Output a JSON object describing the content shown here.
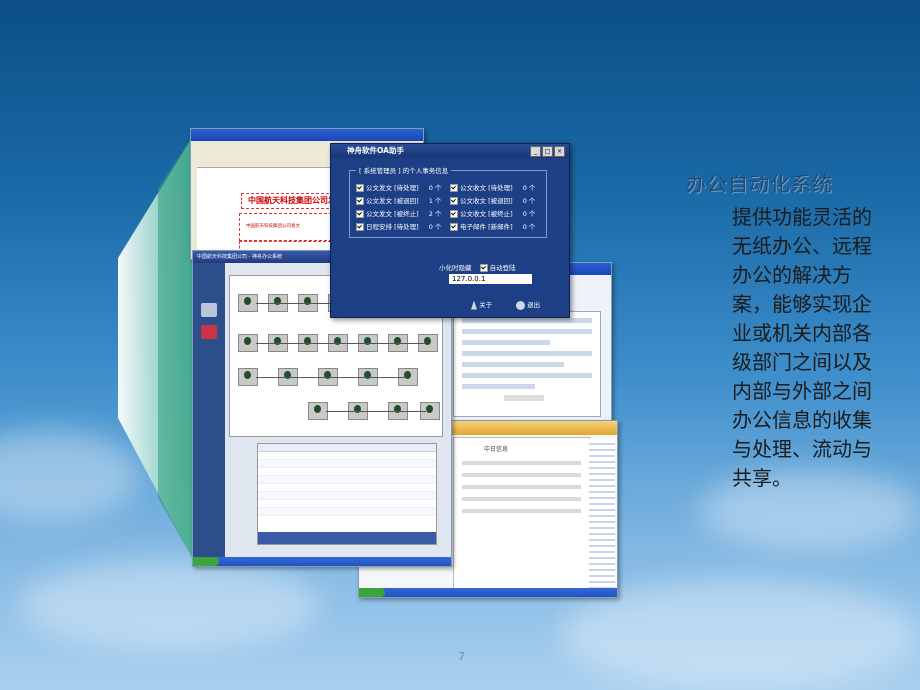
{
  "slide": {
    "heading": "办公自动化系统",
    "body": "提供功能灵活的无纸办公、远程办公的解决方案，能够实现企业或机关内部各级部门之间以及内部与外部之间办公信息的收集与处理、流动与共享。",
    "page_number": "7"
  },
  "collage": {
    "doc_window": {
      "banner": "中国航天科技集团公司发",
      "sub": "中国航天科技集团公司发文"
    },
    "assistant": {
      "title": "神舟软件OA助手",
      "group_label": "[ 系统管理员 ] 的个人事务信息",
      "items": [
        {
          "label": "公文发文 [待处理]",
          "count": "0 个"
        },
        {
          "label": "公文收文 [待处理]",
          "count": "0 个"
        },
        {
          "label": "公文发文 [被退回]",
          "count": "1 个"
        },
        {
          "label": "公文收文 [被退回]",
          "count": "0 个"
        },
        {
          "label": "公文发文 [被终止]",
          "count": "2 个"
        },
        {
          "label": "公文收文 [被终止]",
          "count": "0 个"
        },
        {
          "label": "日程安排 [待处理]",
          "count": "0 个"
        },
        {
          "label": "电子邮件 [新邮件]",
          "count": "0 个"
        }
      ],
      "option_hide": "小化时隐藏",
      "option_autologin": "自动登陆",
      "ip": "127.0.0.1",
      "about_label": "关于",
      "exit_label": "退出"
    },
    "workflow_window": {
      "title": "中国航天科技集团公司 - 神舟办公系统"
    },
    "portal_window": {
      "label": "中日信息"
    }
  }
}
